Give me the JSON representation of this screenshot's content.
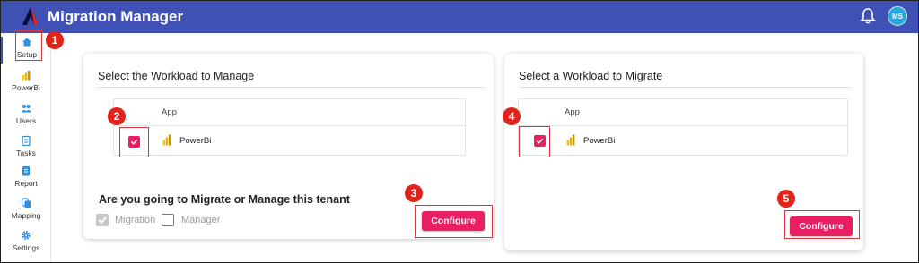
{
  "app": {
    "title": "Migration Manager",
    "avatar_initials": "MS"
  },
  "sidebar": {
    "items": [
      {
        "label": "Setup",
        "icon": "home-icon"
      },
      {
        "label": "PowerBi",
        "icon": "powerbi-icon"
      },
      {
        "label": "Users",
        "icon": "users-icon"
      },
      {
        "label": "Tasks",
        "icon": "tasks-icon"
      },
      {
        "label": "Report",
        "icon": "report-icon"
      },
      {
        "label": "Mapping",
        "icon": "mapping-icon"
      },
      {
        "label": "Settings",
        "icon": "settings-icon"
      }
    ]
  },
  "manage_card": {
    "title": "Select the Workload to Manage",
    "column_header": "App",
    "rows": [
      {
        "label": "PowerBi",
        "checked": true
      }
    ],
    "question": "Are you going to Migrate or Manage this tenant",
    "options": [
      {
        "label": "Migration",
        "checked": true,
        "disabled": true
      },
      {
        "label": "Manager",
        "checked": false
      }
    ],
    "button": "Configure"
  },
  "migrate_card": {
    "title": "Select a Workload to Migrate",
    "column_header": "App",
    "rows": [
      {
        "label": "PowerBi",
        "checked": true
      }
    ],
    "button": "Configure"
  },
  "step_badges": [
    "1",
    "2",
    "3",
    "4",
    "5"
  ],
  "colors": {
    "topbar": "#3f51b5",
    "accent": "#e91e63",
    "badge": "#e0241b",
    "avatar": "#29a8e0",
    "annotation_box": "#d9343a"
  }
}
